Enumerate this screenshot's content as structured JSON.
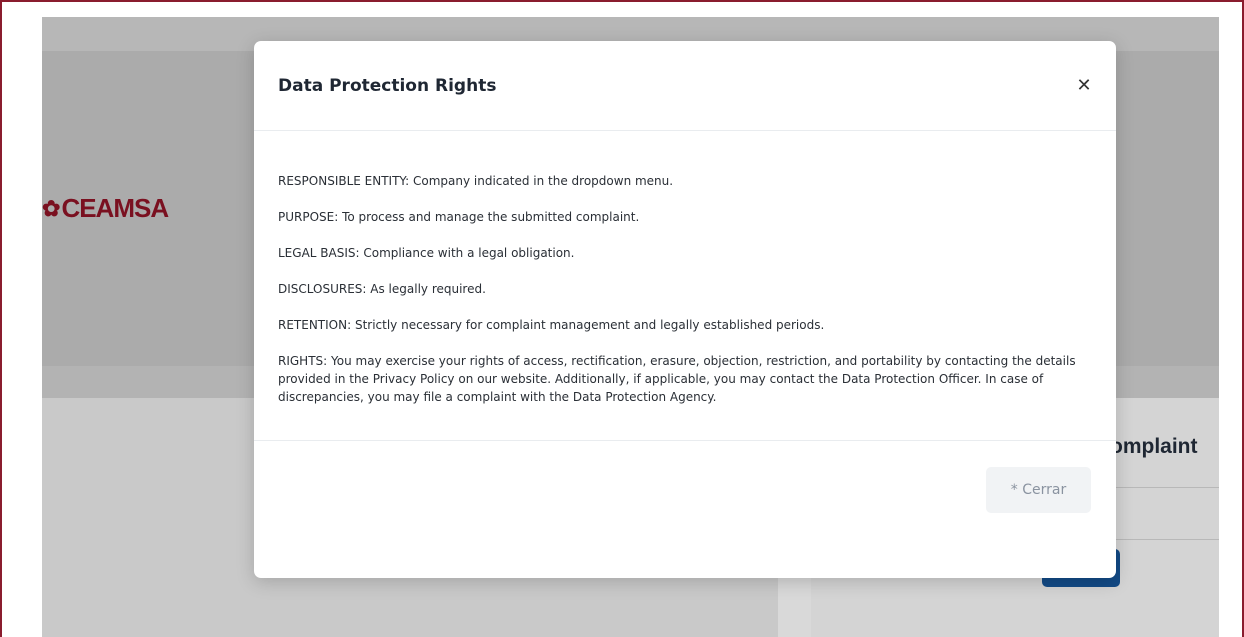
{
  "background": {
    "logo_text": "CEAMSA",
    "complaint_heading_partial": "omplaint"
  },
  "modal": {
    "title": "Data Protection Rights",
    "close_glyph": "✕",
    "paragraphs": [
      "RESPONSIBLE ENTITY: Company indicated in the dropdown menu.",
      "PURPOSE: To process and manage the submitted complaint.",
      "LEGAL BASIS: Compliance with a legal obligation.",
      "DISCLOSURES: As legally required.",
      "RETENTION: Strictly necessary for complaint management and legally established periods.",
      "RIGHTS: You may exercise your rights of access, rectification, erasure, objection, restriction, and portability by contacting the details provided in the Privacy Policy on our website. Additionally, if applicable, you may contact the Data Protection Officer. In case of discrepancies, you may file a complaint with the Data Protection Agency."
    ],
    "footer_button_label": "* Cerrar"
  },
  "colors": {
    "brand": "#7a1020",
    "frame_border": "#8a1c2e",
    "primary_button_bg": "#124a86"
  }
}
